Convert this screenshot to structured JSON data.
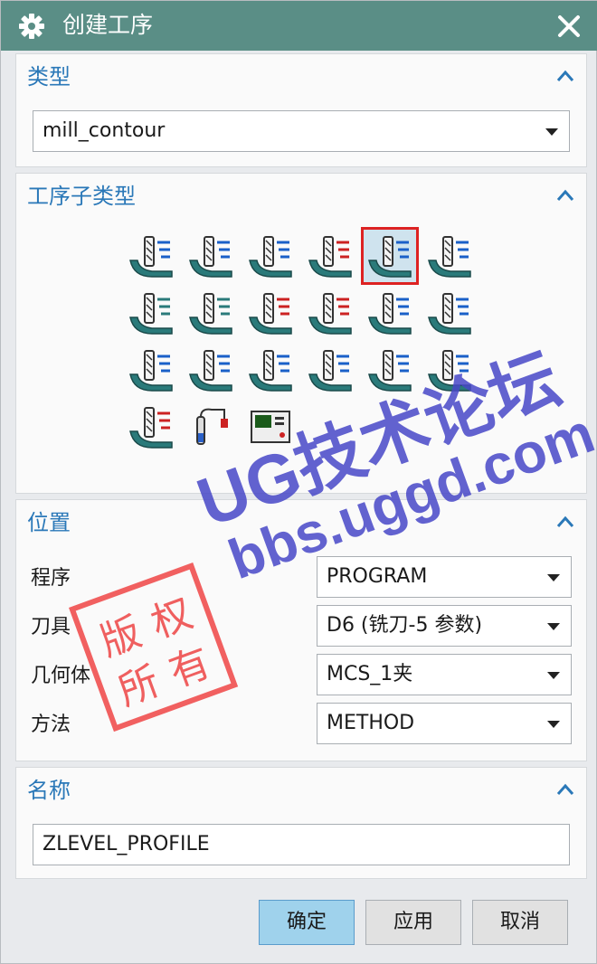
{
  "window": {
    "title": "创建工序",
    "icons": {
      "app": "gear-icon",
      "close": "close-icon"
    }
  },
  "type_panel": {
    "title": "类型",
    "value": "mill_contour"
  },
  "subtype_panel": {
    "title": "工序子类型",
    "icons": [
      "cavity-mill-icon",
      "adaptive-milling-icon",
      "plunge-milling-icon",
      "corner-rough-icon",
      "rest-milling-icon",
      "zlevel-profile-icon",
      "zlevel-corner-icon",
      "fixed-contour-icon",
      "contour-area-icon",
      "contour-surface-area-icon",
      "streamline-icon",
      "contour-area-non-steep-icon",
      "contour-area-dir-steep-icon",
      "flowcut-single-icon",
      "flowcut-multiple-icon",
      "flowcut-ref-tool-icon",
      "solid-profile-3d-icon",
      "profile-3d-icon",
      "contour-text-icon",
      "mill-user-icon",
      "mill-control-icon"
    ],
    "selected_index": 4
  },
  "location_panel": {
    "title": "位置",
    "fields": [
      {
        "label": "程序",
        "value": "PROGRAM"
      },
      {
        "label": "刀具",
        "value": "D6 (铣刀-5 参数)"
      },
      {
        "label": "几何体",
        "value": "MCS_1夹"
      },
      {
        "label": "方法",
        "value": "METHOD"
      }
    ]
  },
  "name_panel": {
    "title": "名称",
    "value": "ZLEVEL_PROFILE"
  },
  "buttons": {
    "ok": "确定",
    "apply": "应用",
    "cancel": "取消"
  },
  "watermark": {
    "line1": "UG技术论坛",
    "line2": "bbs.uggd.com",
    "stamp": [
      "版",
      "权",
      "所",
      "有"
    ]
  },
  "colors": {
    "titlebar": "#5a8e86",
    "section_title": "#2a78b8",
    "selection": "#dd2222",
    "primary_button": "#9fd2ec"
  }
}
